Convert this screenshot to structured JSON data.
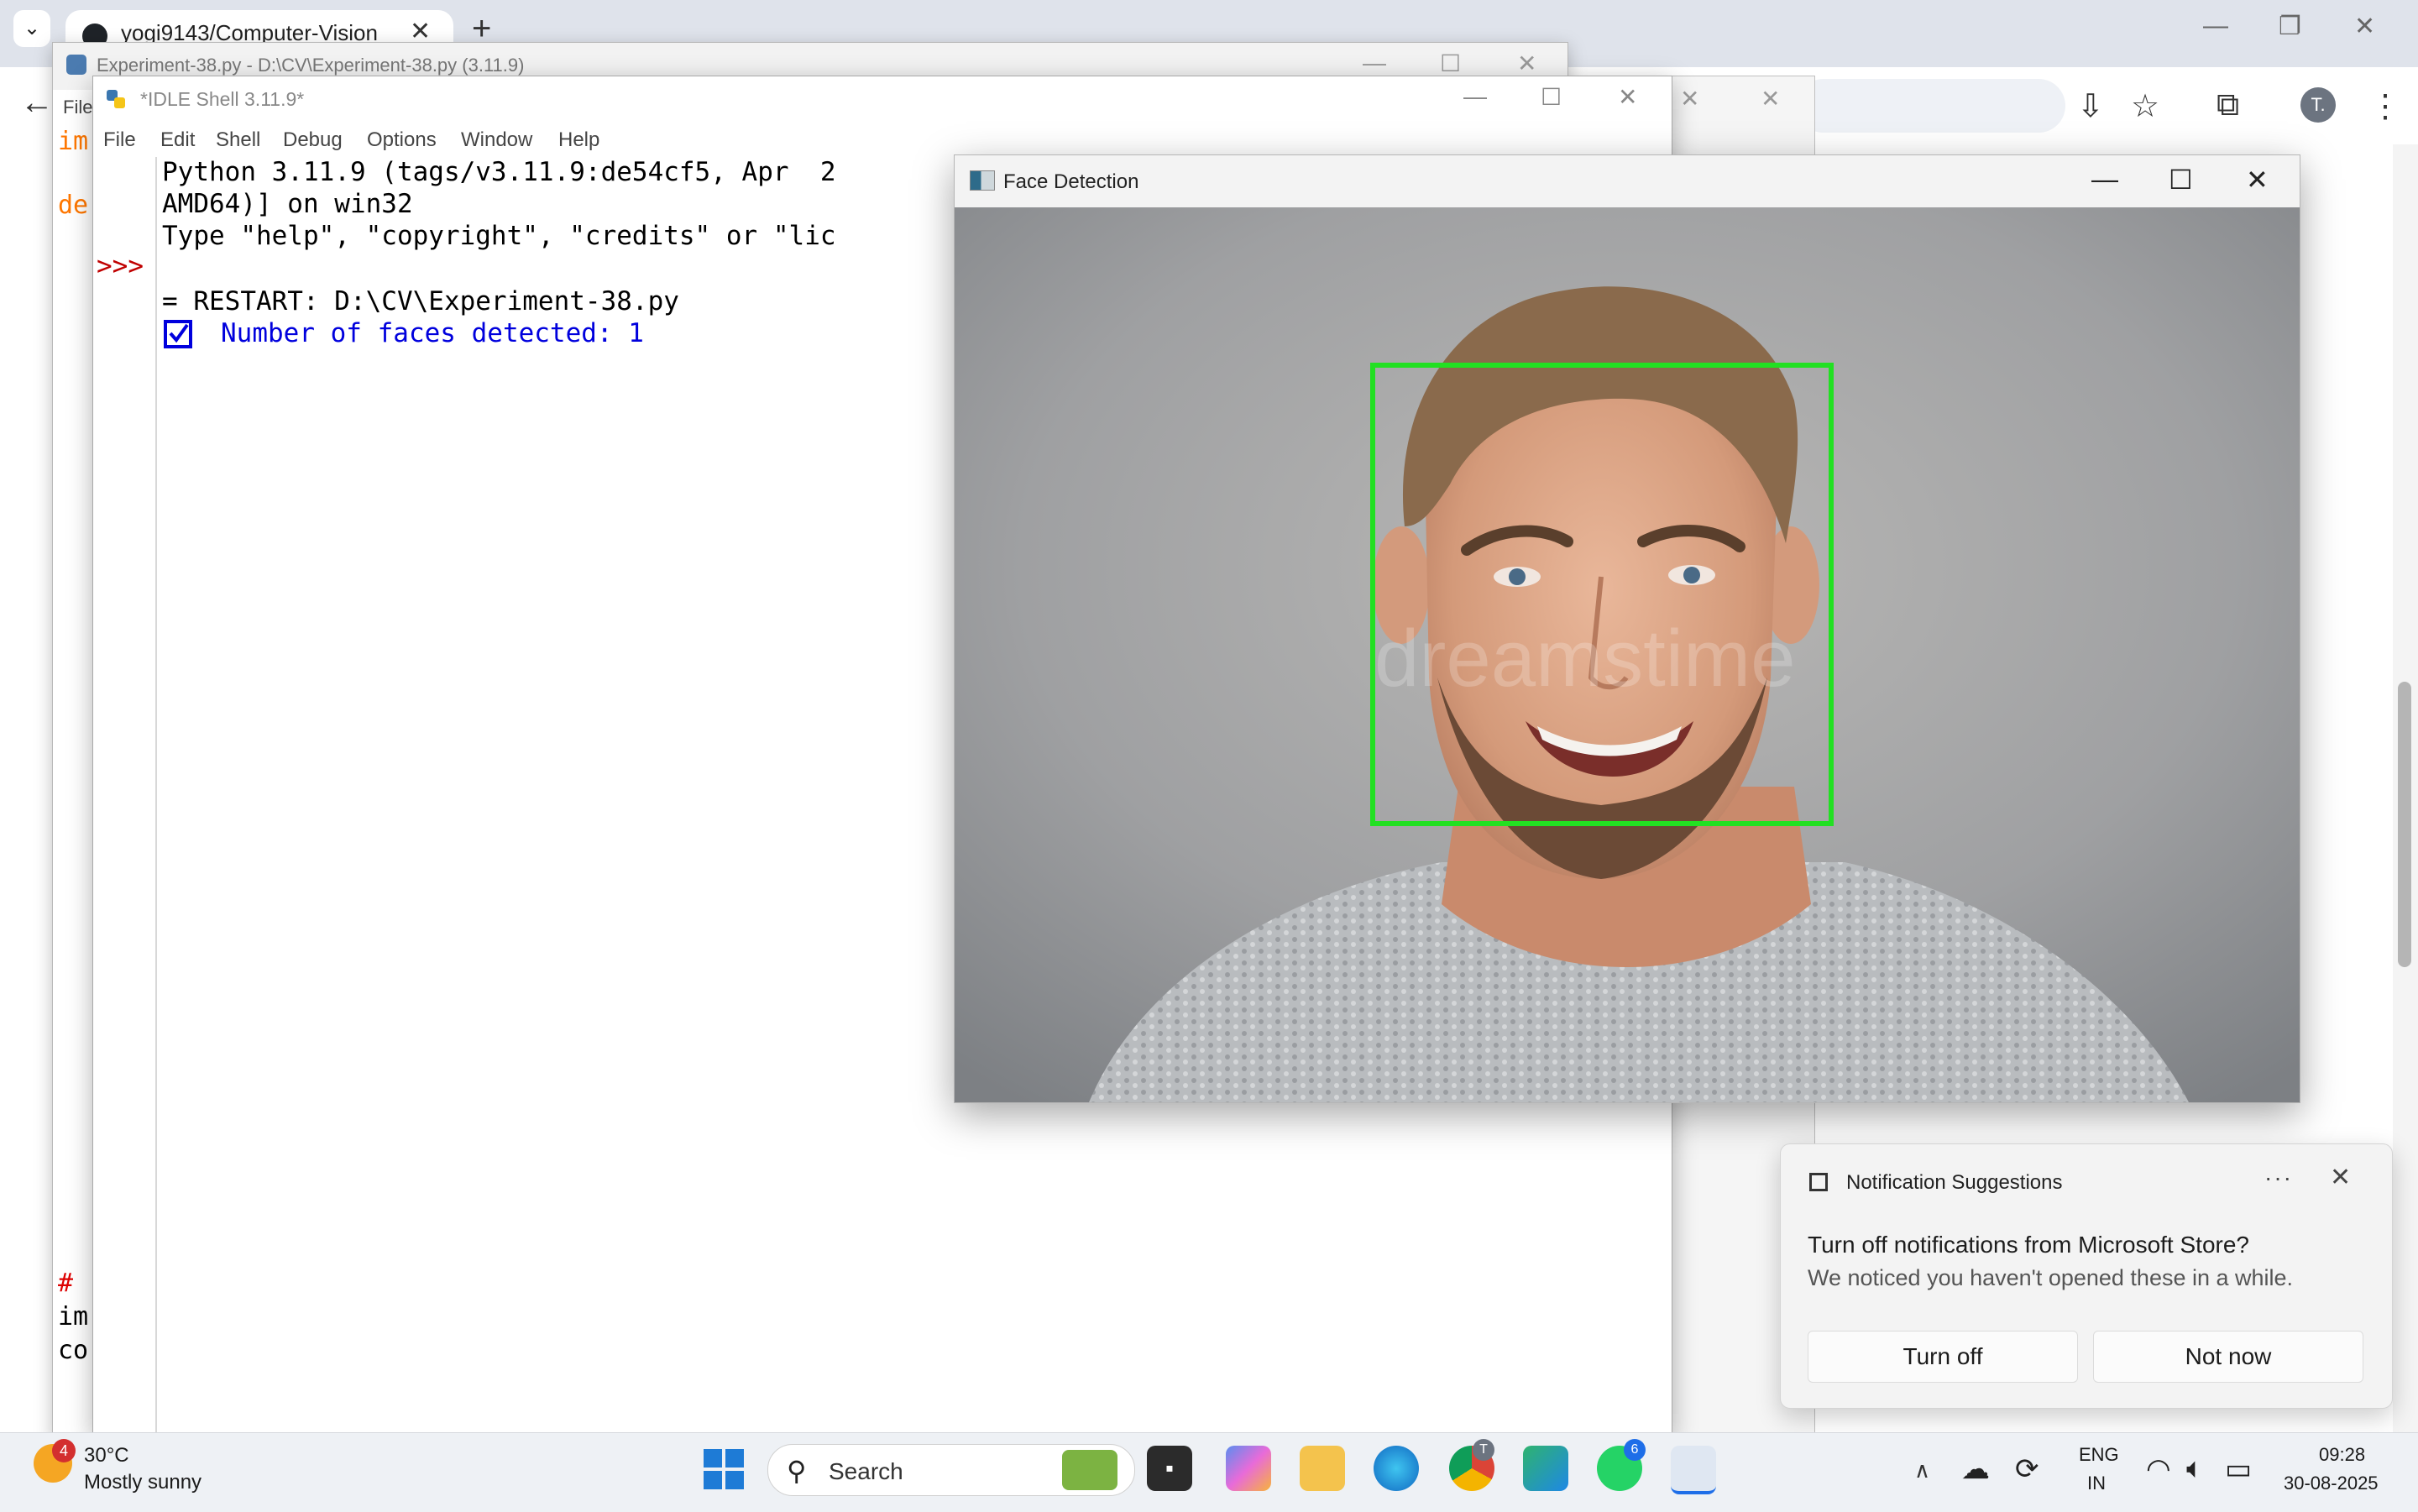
{
  "browser": {
    "tab_title": "yogi9143/Computer-Vision",
    "new_tab": "+",
    "close": "✕",
    "dropdown": "⌄",
    "back": "←",
    "profile_initial": "T."
  },
  "editor": {
    "title": "Experiment-38.py - D:\\CV\\Experiment-38.py (3.11.9)",
    "menu_file": "File",
    "code_lines": [
      {
        "text": "im",
        "color": "#ff7700"
      },
      {
        "text": "de",
        "color": "#ff7700"
      },
      {
        "text": "#",
        "color": "#dd0000"
      },
      {
        "text": "im",
        "color": "#000000"
      },
      {
        "text": "co",
        "color": "#000000"
      }
    ]
  },
  "shell": {
    "title": "*IDLE Shell 3.11.9*",
    "menu": [
      "File",
      "Edit",
      "Shell",
      "Debug",
      "Options",
      "Window",
      "Help"
    ],
    "prompt": ">>>",
    "lines": [
      "Python 3.11.9 (tags/v3.11.9:de54cf5, Apr  2",
      "AMD64)] on win32",
      "Type \"help\", \"copyright\", \"credits\" or \"lic",
      "= RESTART: D:\\CV\\Experiment-38.py"
    ],
    "output": "Number of faces detected: 1"
  },
  "face_window": {
    "title": "Face Detection",
    "detection_box_color": "#22e022",
    "watermark": "dreamstime"
  },
  "notification": {
    "header": "Notification Suggestions",
    "more": "···",
    "close": "✕",
    "title": "Turn off notifications from Microsoft Store?",
    "body": "We noticed you haven't opened these in a while.",
    "btn_turn_off": "Turn off",
    "btn_not_now": "Not now"
  },
  "taskbar": {
    "weather_badge": "4",
    "weather_temp": "30°C",
    "weather_desc": "Mostly sunny",
    "search_label": "Search",
    "chrome_badge": "T",
    "whatsapp_badge": "6",
    "lang_line1": "ENG",
    "lang_line2": "IN",
    "time": "09:28",
    "date": "30-08-2025"
  }
}
